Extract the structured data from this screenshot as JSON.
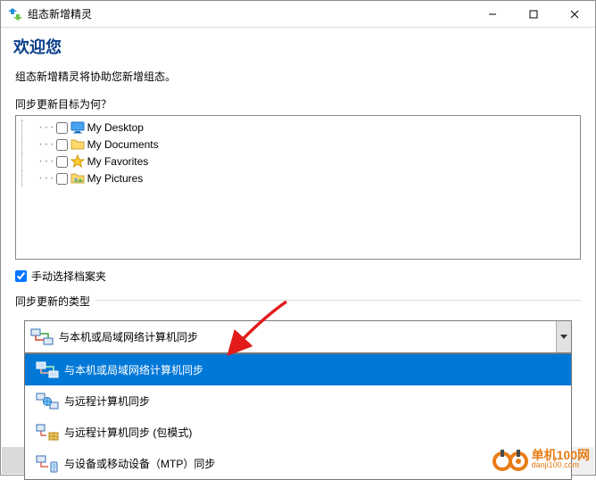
{
  "window": {
    "title": "组态新增精灵"
  },
  "header": {
    "welcome": "欢迎您"
  },
  "intro": "组态新增精灵将协助您新增组态。",
  "target": {
    "question": "同步更新目标为何？",
    "items": [
      {
        "label": "My Desktop",
        "checked": false
      },
      {
        "label": "My Documents",
        "checked": false
      },
      {
        "label": "My Favorites",
        "checked": false
      },
      {
        "label": "My Pictures",
        "checked": false
      }
    ],
    "manual_select": {
      "label": "手动选择档案夹",
      "checked": true
    }
  },
  "sync_type": {
    "legend": "同步更新的类型",
    "selected": "与本机或局域网络计算机同步",
    "options": [
      "与本机或局域网络计算机同步",
      "与远程计算机同步",
      "与远程计算机同步 (包模式)",
      "与设备或移动设备（MTP）同步"
    ]
  },
  "watermark": {
    "cn": "单机100网",
    "url": "danji100.com"
  }
}
